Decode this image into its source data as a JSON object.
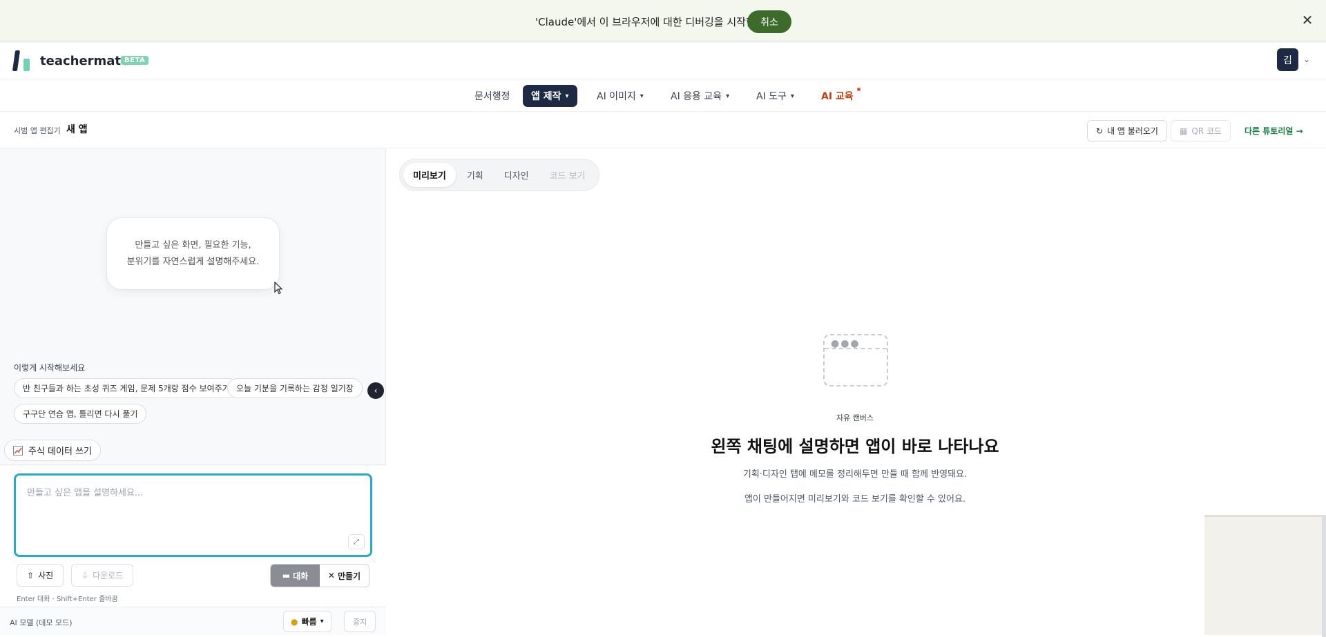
{
  "debug_banner": {
    "message": "'Claude'에서 이 브라우저에 대한 디버깅을 시작함",
    "cancel_label": "취소",
    "close_symbol": "✕"
  },
  "header": {
    "brand": "teachermate",
    "badge": "BETA",
    "avatar_initial": "김"
  },
  "nav": {
    "items": [
      {
        "label": "문서행정"
      },
      {
        "label": "앱 제작"
      },
      {
        "label": "AI 이미지"
      },
      {
        "label": "AI 응용 교육"
      },
      {
        "label": "AI 도구"
      },
      {
        "label": "AI 교육"
      }
    ]
  },
  "subheader": {
    "editor_label": "시범 앱 편집기",
    "title": "새 앱",
    "load_button": "내 앱 불러오기",
    "qr_button": "QR 코드",
    "tutorial_link": "다른 튜토리얼 →"
  },
  "left": {
    "hint_line1": "만들고 싶은 화면, 필요한 기능,",
    "hint_line2": "분위기를 자연스럽게 설명해주세요.",
    "start_label": "이렇게 시작해보세요",
    "suggestions": [
      "반 친구들과 하는 초성 퀴즈 게임, 문제 5개랑 점수 보여주기",
      "오늘 기분을 기록하는 감정 일기장",
      "구구단 연습 앱, 틀리면 다시 풀기"
    ],
    "stock_button": "주식 데이터 쓰기",
    "prompt_placeholder": "만들고 싶은 앱을 설명하세요...",
    "photo_button": "사진",
    "download_button": "다운로드",
    "mode_chat": "대화",
    "mode_make": "만들기",
    "shortcut_hint": "Enter 대화 · Shift+Enter 줄바꿈",
    "model_label": "AI 모델 (데모 모드)",
    "speed_button": "빠름",
    "stop_button": "중지"
  },
  "right": {
    "tabs": [
      {
        "label": "미리보기",
        "state": "active"
      },
      {
        "label": "기획",
        "state": "normal"
      },
      {
        "label": "디자인",
        "state": "normal"
      },
      {
        "label": "코드 보기",
        "state": "disabled"
      }
    ],
    "canvas_label": "자유 캔버스",
    "canvas_title": "왼쪽 채팅에 설명하면 앱이 바로 나타나요",
    "canvas_desc1": "기획·디자인 탭에 메모를 정리해두면 만들 때 함께 반영돼요.",
    "canvas_desc2": "앱이 만들어지면 미리보기와 코드 보기를 확인할 수 있어요."
  },
  "colors": {
    "navy": "#1e2a44",
    "brand_green": "#3d6b2c",
    "mint": "#6ed3b0",
    "focus_blue": "#25a9cf",
    "accent_orange": "#c2410c",
    "tutorial_green": "#15803d"
  },
  "icons": [
    "close-icon",
    "chevron-down-icon",
    "refresh-icon",
    "qr-icon",
    "upload-icon",
    "download-icon",
    "book-icon",
    "tools-icon",
    "lock-icon",
    "expand-icon",
    "chevron-left-icon",
    "chart-icon",
    "cursor-icon"
  ]
}
